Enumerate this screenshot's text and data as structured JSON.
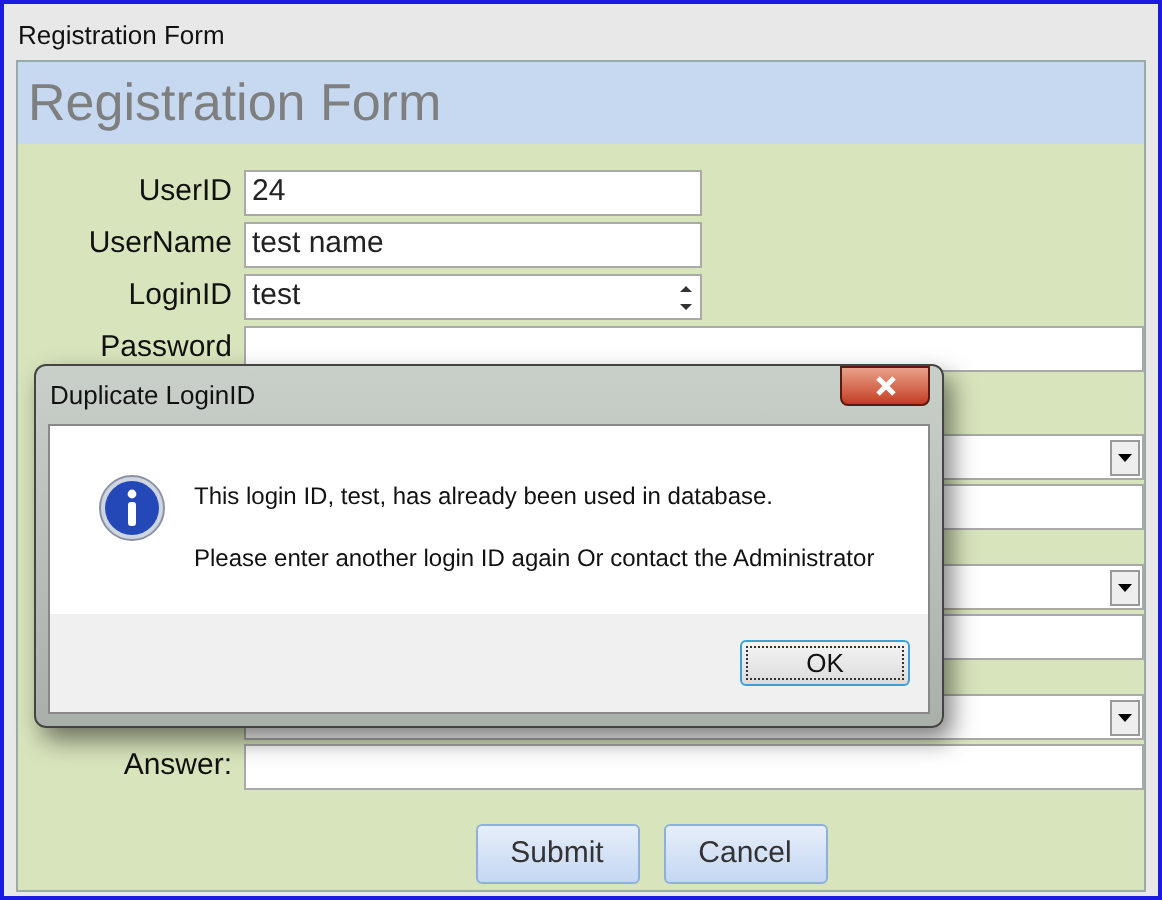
{
  "window": {
    "title": "Registration Form"
  },
  "form": {
    "heading": "Registration Form",
    "fields": [
      {
        "label": "UserID",
        "value": "24",
        "kind": "text"
      },
      {
        "label": "UserName",
        "value": "test name",
        "kind": "text"
      },
      {
        "label": "LoginID",
        "value": "test",
        "kind": "spin"
      },
      {
        "label": "Password",
        "kind": "password"
      }
    ],
    "security_groups": [
      {
        "question": {
          "kind": "dropdown"
        },
        "answer": {
          "kind": "text"
        }
      },
      {
        "question": {
          "kind": "dropdown"
        },
        "answer": {
          "kind": "text"
        }
      },
      {
        "question": {
          "kind": "dropdown"
        },
        "answer": {
          "label": "Answer:",
          "kind": "text"
        }
      }
    ],
    "buttons": [
      "Submit",
      "Cancel"
    ]
  },
  "dialog": {
    "title": "Duplicate LoginID",
    "messages": [
      "This login ID, test, has already been used in database.",
      "Please enter another login ID again Or contact the Administrator"
    ],
    "button": "OK"
  }
}
